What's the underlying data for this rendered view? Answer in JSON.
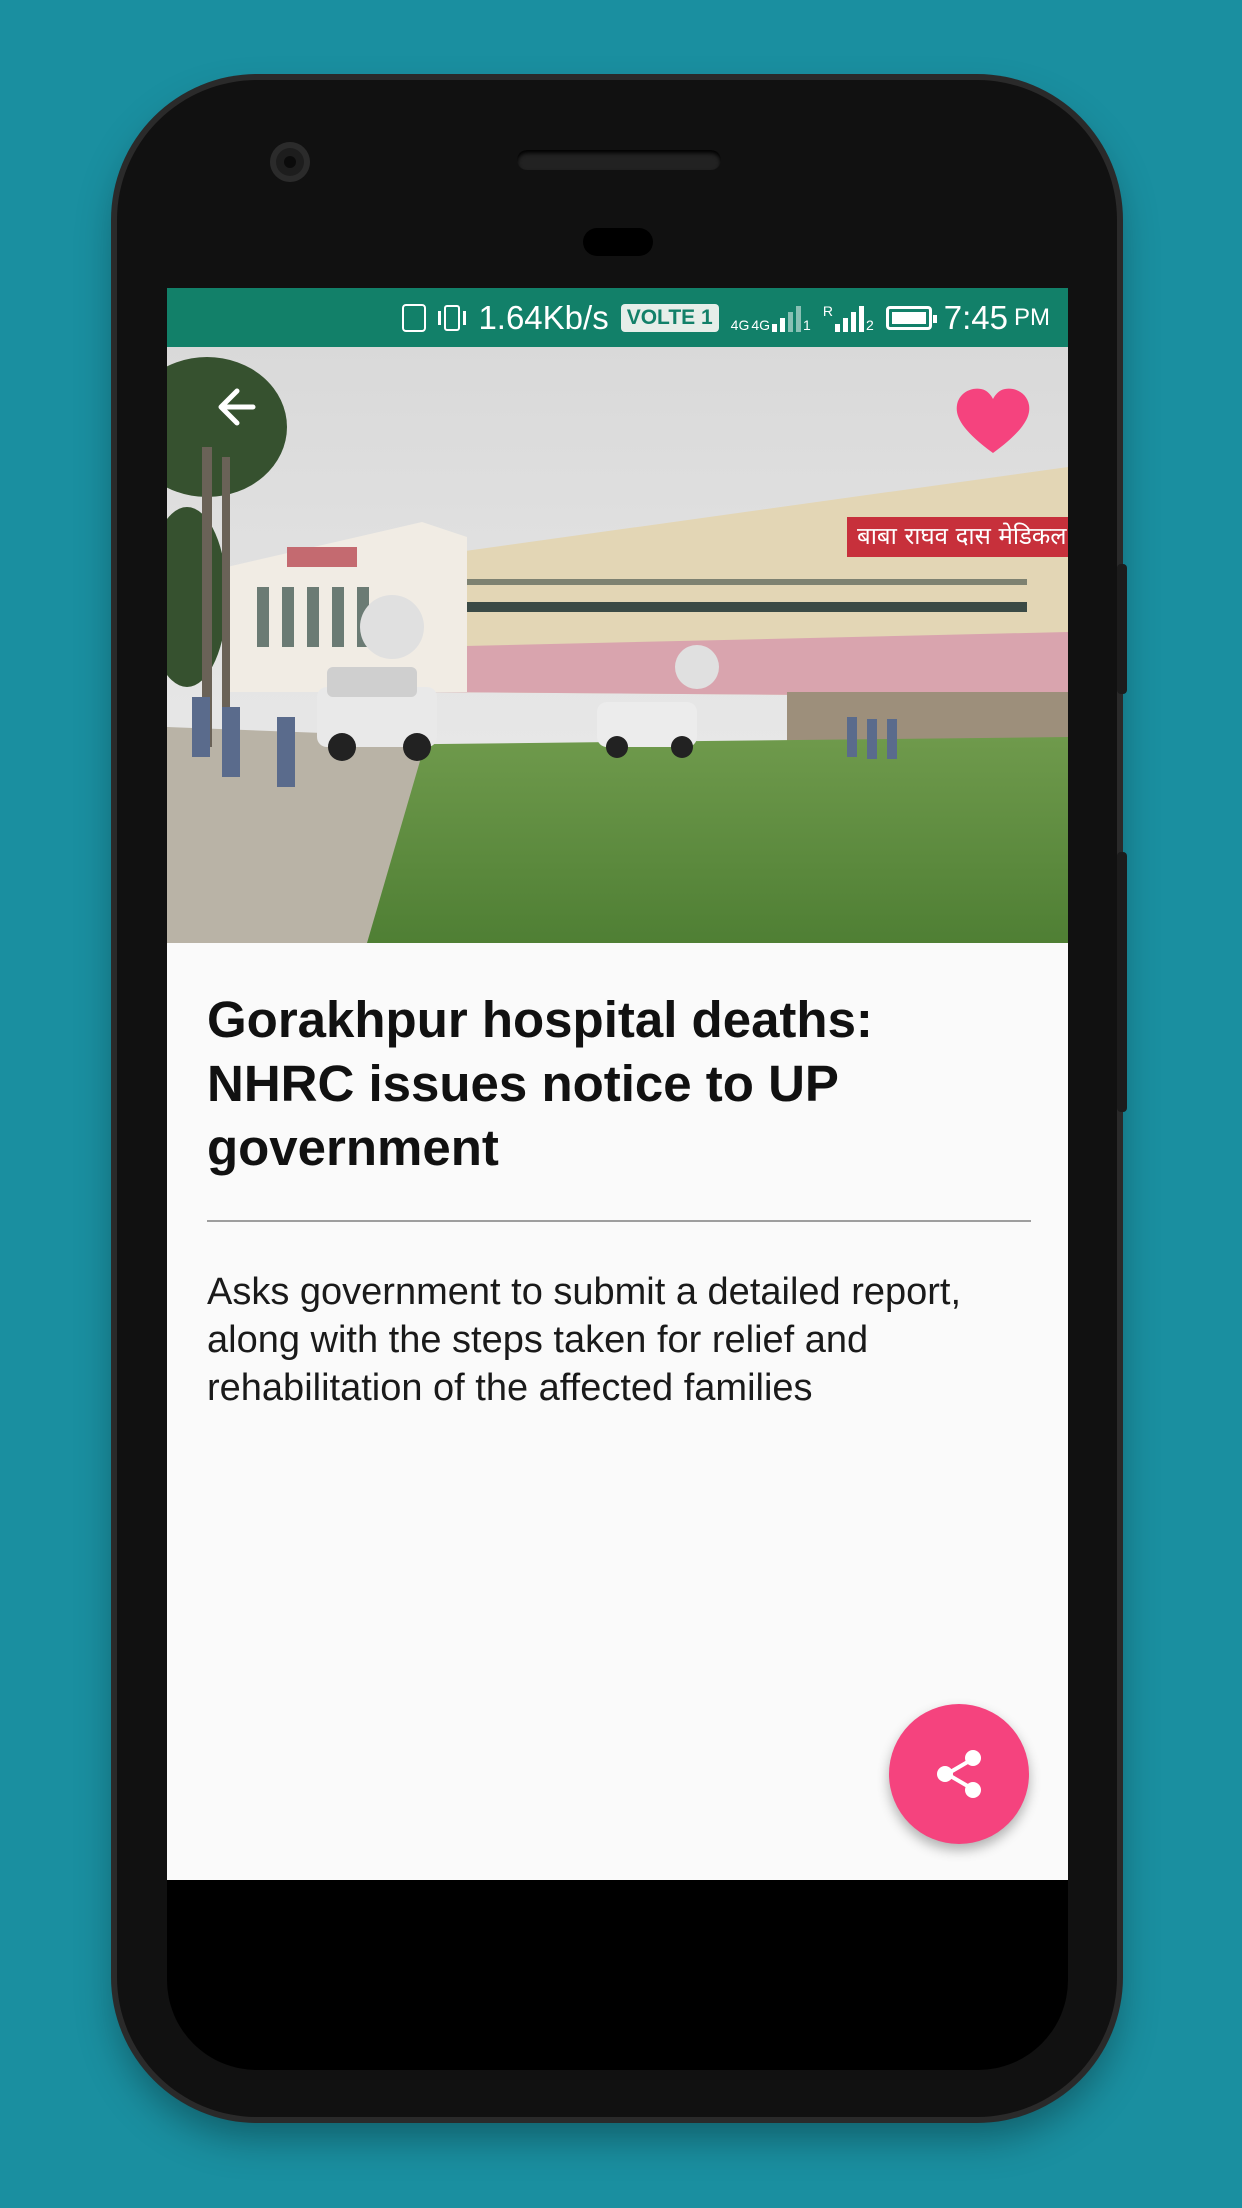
{
  "status_bar": {
    "speed": "1.64Kb/s",
    "volte": "VOLTE 1",
    "net1": "4G",
    "net2": "4G",
    "sim1_index": "1",
    "roaming": "R",
    "sim2_index": "2",
    "time": "7:45",
    "ampm": "PM",
    "battery_level": 1.0
  },
  "article": {
    "headline": "Gorakhpur hospital deaths: NHRC issues notice to UP government",
    "summary": "Asks government to submit a detailed report, along with the steps taken for relief and rehabilitation of the affected families",
    "image_banner_text": "बाबा राघव दास मेडिकल का"
  },
  "icons": {
    "back": "arrow-left-icon",
    "favorite": "heart-icon",
    "share": "share-icon"
  },
  "colors": {
    "background": "#1a8fa0",
    "status_bar": "#128069",
    "accent": "#f5437e"
  }
}
